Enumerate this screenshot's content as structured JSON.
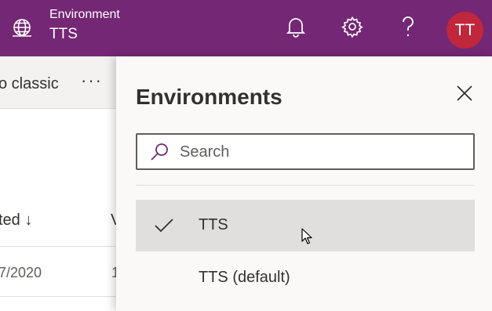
{
  "header": {
    "environment_label": "Environment",
    "environment_name": "TTS",
    "avatar_initials": "TT",
    "brand_color": "#742774",
    "avatar_color": "#c0263c",
    "icons": [
      "globe-icon",
      "bell-icon",
      "gear-icon",
      "help-icon"
    ]
  },
  "background_page": {
    "command_text": "o classic",
    "more_label": "···",
    "column_header": "ted ↓",
    "column_header_2": "V",
    "row_date": "7/2020",
    "row_value": "1"
  },
  "panel": {
    "title": "Environments",
    "search": {
      "placeholder": "Search",
      "value": ""
    },
    "items": [
      {
        "label": "TTS",
        "selected": true
      },
      {
        "label": "TTS (default)",
        "selected": false
      }
    ]
  }
}
